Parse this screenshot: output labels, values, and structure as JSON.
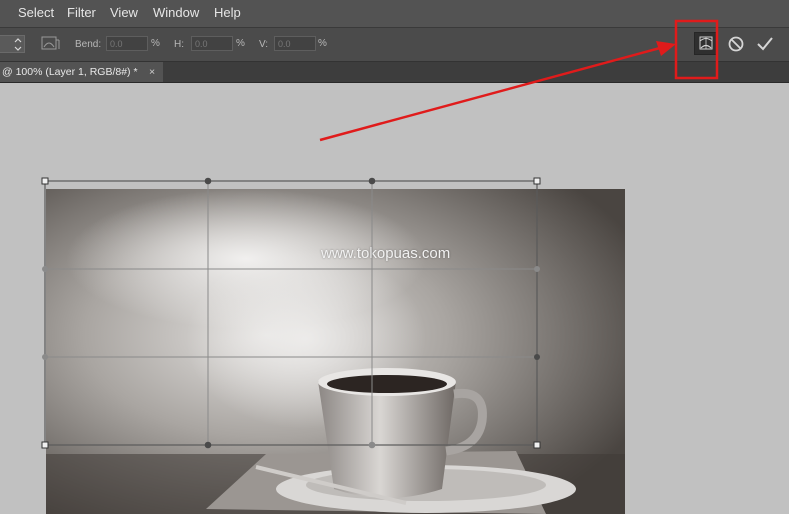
{
  "menubar": {
    "items": [
      {
        "label": "Select"
      },
      {
        "label": "Filter"
      },
      {
        "label": "View"
      },
      {
        "label": "Window"
      },
      {
        "label": "Help"
      }
    ]
  },
  "options": {
    "bend_label": "Bend:",
    "bend_value": "0.0",
    "h_label": "H:",
    "h_value": "0.0",
    "v_label": "V:",
    "v_value": "0.0",
    "percent": "%"
  },
  "document_tab": {
    "title": "@ 100% (Layer 1, RGB/8#) *",
    "close": "×"
  },
  "canvas": {
    "watermark": "www.tokopuas.com"
  },
  "annotation": {
    "color": "#e01b1b"
  },
  "icons": {
    "warp_mode": "warp-icon",
    "toggle_warp": "toggle-warp-transform-icon",
    "cancel": "cancel-transform-icon",
    "commit": "commit-transform-icon"
  }
}
